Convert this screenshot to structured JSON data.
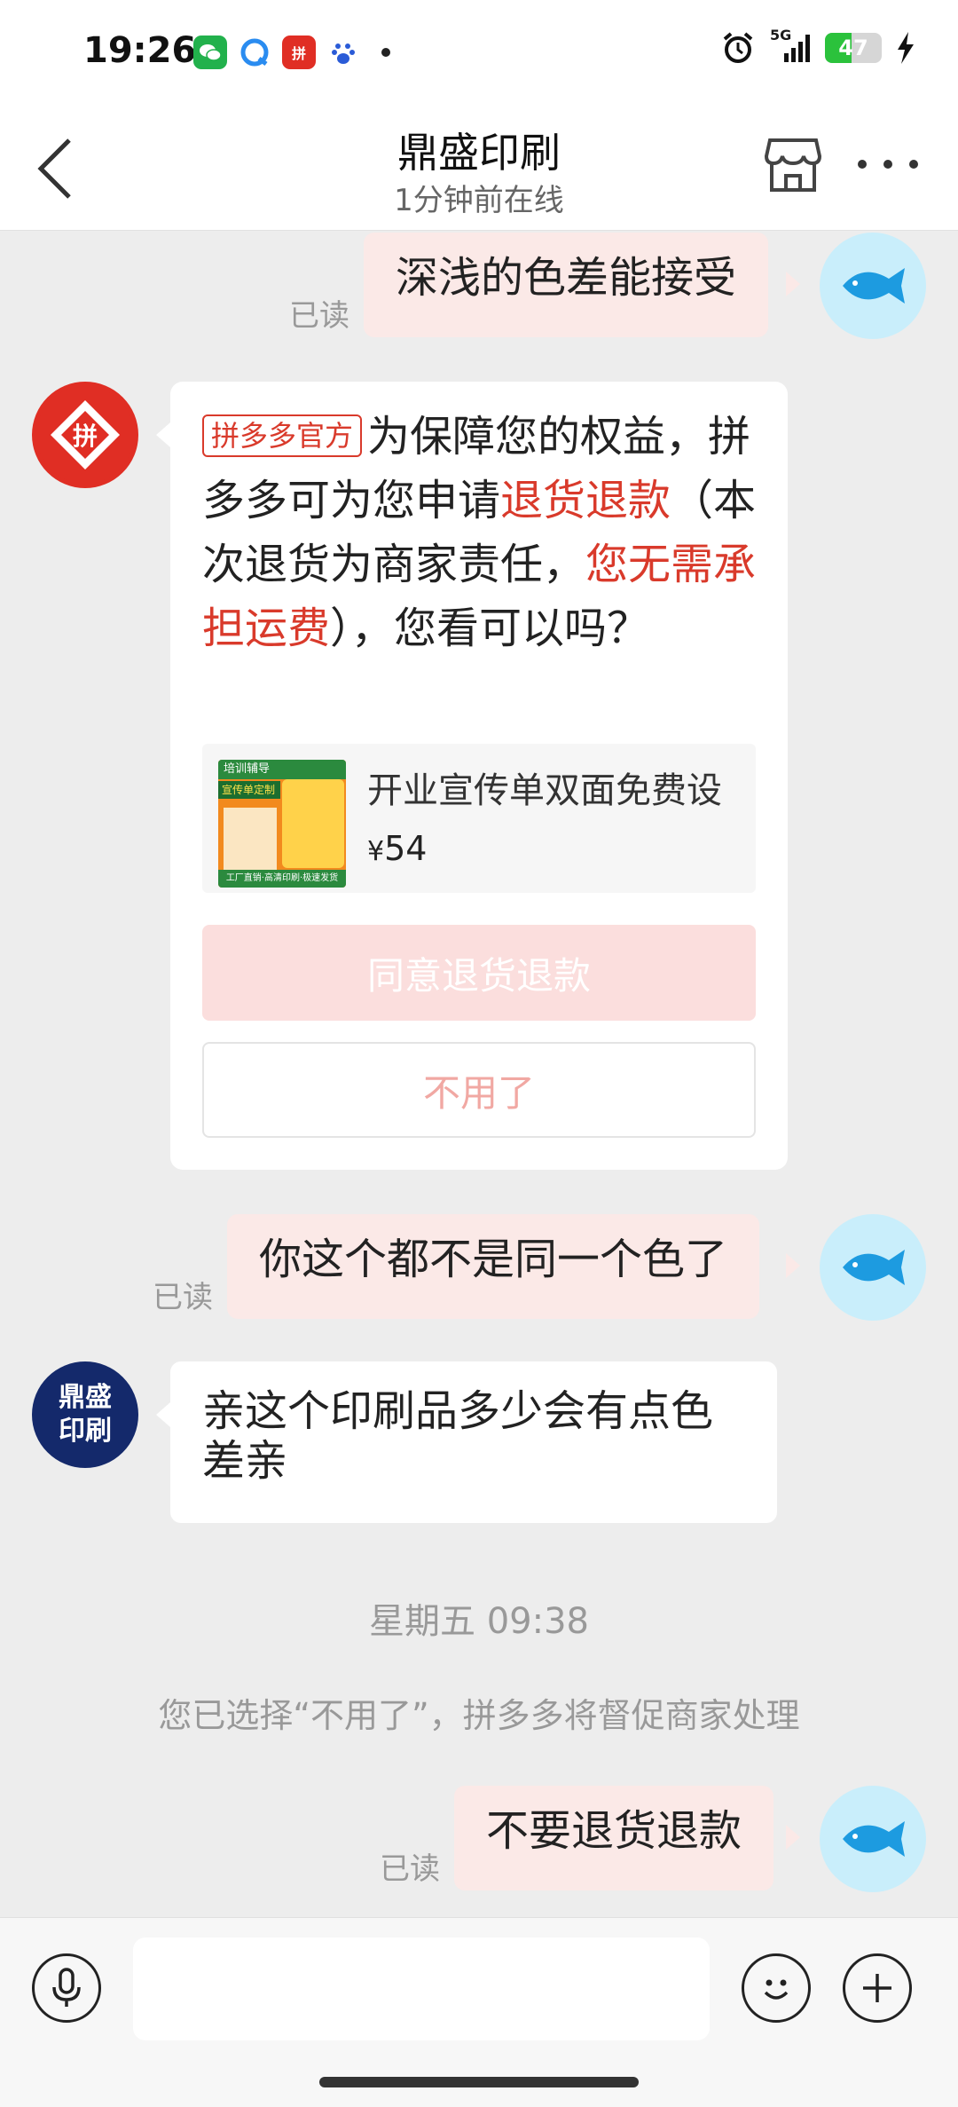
{
  "status_bar": {
    "time": "19:26",
    "network": "5G",
    "battery_level": "47",
    "app_icons": [
      "wechat-icon",
      "browser-icon",
      "pinduoduo-icon",
      "baidu-icon"
    ]
  },
  "header": {
    "title": "鼎盛印刷",
    "subtitle": "1分钟前在线"
  },
  "messages": {
    "m1": {
      "text": "深浅的色差能接受",
      "read": "已读"
    },
    "pdd": {
      "badge": "拼多多官方",
      "part1": "为保障您的权益，拼多多可为您申请",
      "hl1": "退货退款",
      "part2": "（本次退货为商家责任，",
      "hl2": "您无需承担运费",
      "part3": "），您看可以吗？",
      "product_name": "开业宣传单双面免费设",
      "currency": "¥",
      "price": "54",
      "agree_button": "同意退货退款",
      "decline_button": "不用了"
    },
    "m2": {
      "text": "你这个都不是同一个色了",
      "read": "已读"
    },
    "m3": {
      "text": "亲这个印刷品多少会有点色差亲",
      "avatar_text": "鼎盛印刷"
    },
    "timestamp": "星期五 09:38",
    "system_notice": "您已选择“不用了”，拼多多将督促商家处理",
    "m4": {
      "text": "不要退货退款",
      "read": "已读"
    }
  },
  "thumb": {
    "label1": "培训辅导",
    "label2": "宣传单定制",
    "footer": "工厂直销·高清印刷·极速发货"
  },
  "colors": {
    "accent_red": "#d93a2b",
    "my_bubble": "#fbe9e7",
    "background": "#ededed"
  }
}
